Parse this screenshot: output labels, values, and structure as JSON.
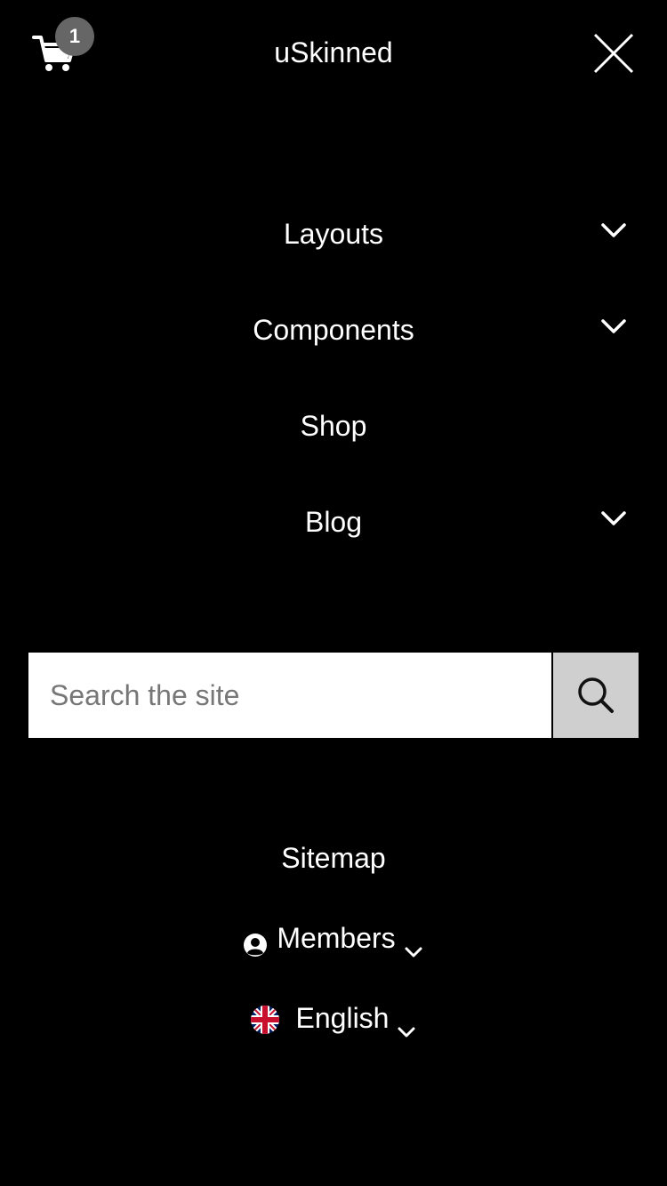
{
  "header": {
    "brand": "uSkinned",
    "cart_count": "1"
  },
  "nav": {
    "items": [
      {
        "label": "Layouts",
        "has_submenu": true
      },
      {
        "label": "Components",
        "has_submenu": true
      },
      {
        "label": "Shop",
        "has_submenu": false
      },
      {
        "label": "Blog",
        "has_submenu": true
      }
    ]
  },
  "search": {
    "placeholder": "Search the site",
    "value": ""
  },
  "footer": {
    "sitemap": "Sitemap",
    "members": "Members",
    "language": "English"
  },
  "colors": {
    "background": "#000000",
    "text": "#ffffff",
    "badge": "#666666",
    "search_button": "#cfcfcf"
  },
  "icons": {
    "cart": "cart-icon",
    "close": "close-icon",
    "chevron": "chevron-down-icon",
    "search": "search-icon",
    "user": "user-circle-icon",
    "flag": "uk-flag-icon"
  }
}
